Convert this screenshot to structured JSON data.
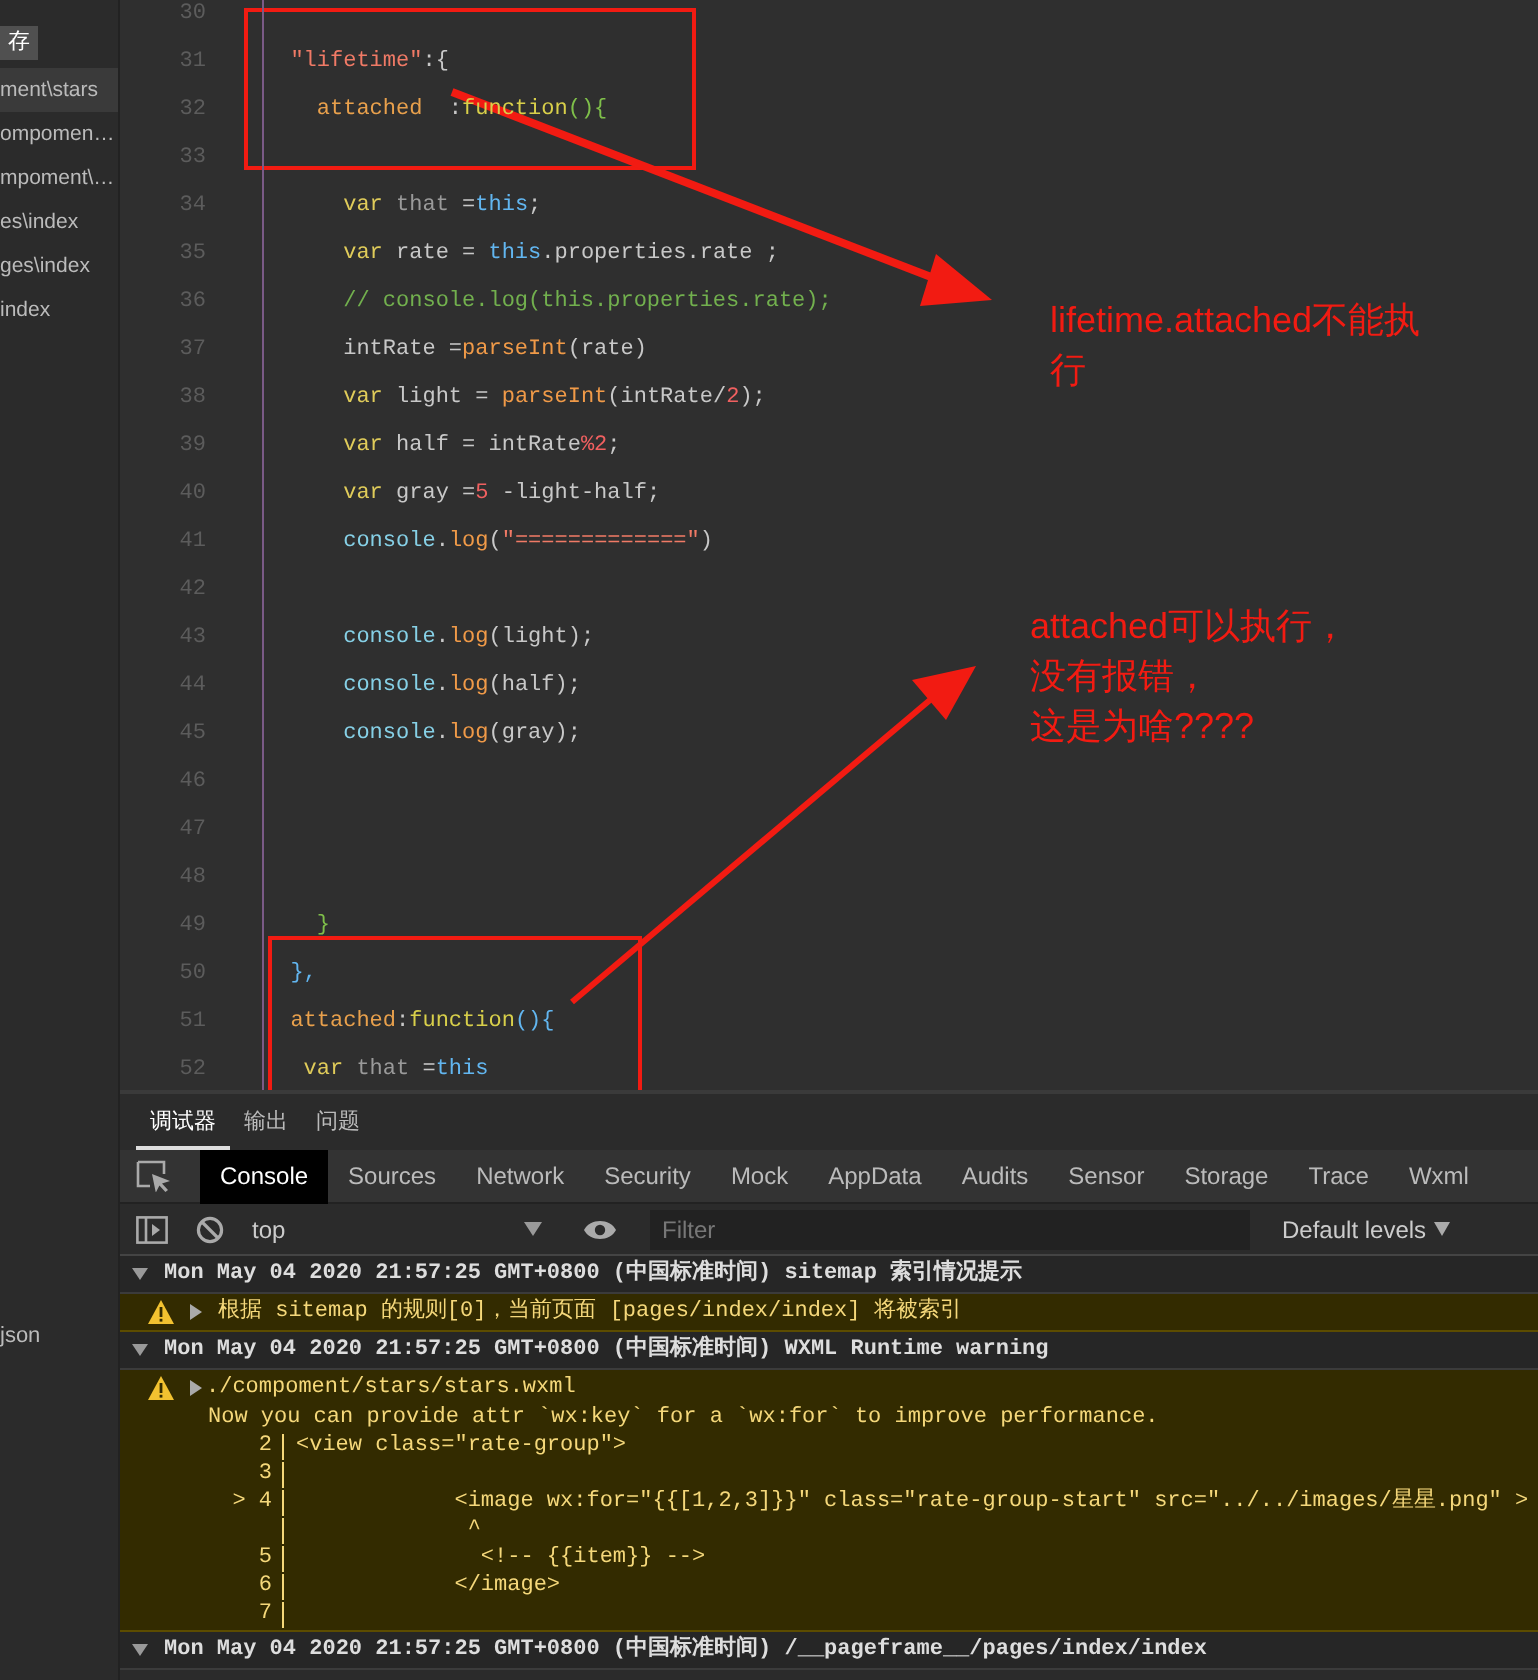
{
  "sidebar": {
    "tag": "存",
    "items": [
      {
        "label": "ment\\stars",
        "selected": true
      },
      {
        "label": "ompomen…",
        "selected": false
      },
      {
        "label": "mpoment\\…",
        "selected": false
      },
      {
        "label": "es\\index",
        "selected": false
      },
      {
        "label": "ges\\index",
        "selected": false
      },
      {
        "label": "index",
        "selected": false
      }
    ],
    "bottom_item": "json"
  },
  "editor": {
    "lines": [
      {
        "number": "30"
      },
      {
        "number": "31",
        "tokens": [
          {
            "text": "  \"lifetime\"",
            "kind": "string"
          },
          {
            "text": ":{",
            "kind": "plain"
          }
        ]
      },
      {
        "number": "32",
        "tokens": [
          {
            "text": "    attached",
            "kind": "prop"
          },
          {
            "text": "  :",
            "kind": "plain"
          },
          {
            "text": "function",
            "kind": "func"
          },
          {
            "text": "(){",
            "kind": "brace"
          }
        ]
      },
      {
        "number": "33"
      },
      {
        "number": "34",
        "tokens": [
          {
            "text": "      var",
            "kind": "kw"
          },
          {
            "text": " that ",
            "kind": "var"
          },
          {
            "text": "=",
            "kind": "plain"
          },
          {
            "text": "this",
            "kind": "this"
          },
          {
            "text": ";",
            "kind": "plain"
          }
        ]
      },
      {
        "number": "35",
        "tokens": [
          {
            "text": "      var",
            "kind": "kw"
          },
          {
            "text": " rate = ",
            "kind": "plain"
          },
          {
            "text": "this",
            "kind": "this"
          },
          {
            "text": ".properties.rate ;",
            "kind": "plain"
          }
        ]
      },
      {
        "number": "36",
        "tokens": [
          {
            "text": "      // console.log(this.properties.rate);",
            "kind": "comment"
          }
        ]
      },
      {
        "number": "37",
        "tokens": [
          {
            "text": "      intRate =",
            "kind": "plain"
          },
          {
            "text": "parseInt",
            "kind": "call"
          },
          {
            "text": "(rate)",
            "kind": "plain"
          }
        ]
      },
      {
        "number": "38",
        "tokens": [
          {
            "text": "      var",
            "kind": "kw"
          },
          {
            "text": " light = ",
            "kind": "plain"
          },
          {
            "text": "parseInt",
            "kind": "call"
          },
          {
            "text": "(intRate/",
            "kind": "plain"
          },
          {
            "text": "2",
            "kind": "num"
          },
          {
            "text": ");",
            "kind": "plain"
          }
        ]
      },
      {
        "number": "39",
        "tokens": [
          {
            "text": "      var",
            "kind": "kw"
          },
          {
            "text": " half = intRate",
            "kind": "plain"
          },
          {
            "text": "%2",
            "kind": "num"
          },
          {
            "text": ";",
            "kind": "plain"
          }
        ]
      },
      {
        "number": "40",
        "tokens": [
          {
            "text": "      var",
            "kind": "kw"
          },
          {
            "text": " gray =",
            "kind": "plain"
          },
          {
            "text": "5",
            "kind": "num"
          },
          {
            "text": " -light-half;",
            "kind": "plain"
          }
        ]
      },
      {
        "number": "41",
        "tokens": [
          {
            "text": "      console",
            "kind": "console"
          },
          {
            "text": ".",
            "kind": "plain"
          },
          {
            "text": "log",
            "kind": "call"
          },
          {
            "text": "(",
            "kind": "plain"
          },
          {
            "text": "\"=============\"",
            "kind": "string"
          },
          {
            "text": ")",
            "kind": "plain"
          }
        ]
      },
      {
        "number": "42"
      },
      {
        "number": "43",
        "tokens": [
          {
            "text": "      console",
            "kind": "console"
          },
          {
            "text": ".",
            "kind": "plain"
          },
          {
            "text": "log",
            "kind": "call"
          },
          {
            "text": "(light);",
            "kind": "plain"
          }
        ]
      },
      {
        "number": "44",
        "tokens": [
          {
            "text": "      console",
            "kind": "console"
          },
          {
            "text": ".",
            "kind": "plain"
          },
          {
            "text": "log",
            "kind": "call"
          },
          {
            "text": "(half);",
            "kind": "plain"
          }
        ]
      },
      {
        "number": "45",
        "tokens": [
          {
            "text": "      console",
            "kind": "console"
          },
          {
            "text": ".",
            "kind": "plain"
          },
          {
            "text": "log",
            "kind": "call"
          },
          {
            "text": "(gray);",
            "kind": "plain"
          }
        ]
      },
      {
        "number": "46"
      },
      {
        "number": "47"
      },
      {
        "number": "48"
      },
      {
        "number": "49",
        "tokens": [
          {
            "text": "    }",
            "kind": "brace"
          }
        ]
      },
      {
        "number": "50",
        "tokens": [
          {
            "text": "  },",
            "kind": "this"
          }
        ]
      },
      {
        "number": "51",
        "tokens": [
          {
            "text": "  attached",
            "kind": "prop"
          },
          {
            "text": ":",
            "kind": "plain"
          },
          {
            "text": "function",
            "kind": "func"
          },
          {
            "text": "(){",
            "kind": "this"
          }
        ]
      },
      {
        "number": "52",
        "tokens": [
          {
            "text": "   var",
            "kind": "kw"
          },
          {
            "text": " that ",
            "kind": "var"
          },
          {
            "text": "=",
            "kind": "plain"
          },
          {
            "text": "this",
            "kind": "this"
          }
        ]
      }
    ]
  },
  "annotations": [
    {
      "lines": [
        "lifetime.attached不能执",
        "行"
      ]
    },
    {
      "lines": [
        "attached可以执行，",
        "没有报错，",
        "这是为啥????"
      ]
    }
  ],
  "panel_tabs": [
    {
      "label": "调试器",
      "selected": true
    },
    {
      "label": "输出",
      "selected": false
    },
    {
      "label": "问题",
      "selected": false
    }
  ],
  "devtools_tabs": [
    {
      "label": "Console",
      "selected": true
    },
    {
      "label": "Sources",
      "selected": false
    },
    {
      "label": "Network",
      "selected": false
    },
    {
      "label": "Security",
      "selected": false
    },
    {
      "label": "Mock",
      "selected": false
    },
    {
      "label": "AppData",
      "selected": false
    },
    {
      "label": "Audits",
      "selected": false
    },
    {
      "label": "Sensor",
      "selected": false
    },
    {
      "label": "Storage",
      "selected": false
    },
    {
      "label": "Trace",
      "selected": false
    },
    {
      "label": "Wxml",
      "selected": false
    }
  ],
  "toolbar": {
    "context": "top",
    "filter_placeholder": "Filter",
    "levels": "Default levels"
  },
  "console": [
    {
      "kind": "group",
      "expanded": true,
      "text": "Mon May 04 2020 21:57:25 GMT+0800 (中国标准时间) sitemap 索引情况提示"
    },
    {
      "kind": "warning",
      "expanded": false,
      "text": "根据 sitemap 的规则[0]，当前页面 [pages/index/index] 将被索引"
    },
    {
      "kind": "group",
      "expanded": true,
      "text": "Mon May 04 2020 21:57:25 GMT+0800 (中国标准时间) WXML Runtime warning"
    },
    {
      "kind": "warning",
      "expanded": false,
      "text": "./compoment/stars/stars.wxml",
      "message": "Now you can provide attr `wx:key` for a `wx:for` to improve performance.",
      "frame": [
        {
          "num": "2",
          "code": "<view class=\"rate-group\">"
        },
        {
          "num": "3"
        },
        {
          "marker": ">",
          "num": "4",
          "code": "            <image wx:for=\"{{[1,2,3]}}\" class=\"rate-group-start\" src=\"../../images/星星.png\" >"
        },
        {
          "code": "             ^"
        },
        {
          "num": "5",
          "code": "              <!-- {{item}} -->"
        },
        {
          "num": "6",
          "code": "            </image>"
        },
        {
          "num": "7"
        }
      ]
    },
    {
      "kind": "group",
      "expanded": true,
      "text": "Mon May 04 2020 21:57:25 GMT+0800 (中国标准时间) /__pageframe__/pages/index/index"
    }
  ]
}
